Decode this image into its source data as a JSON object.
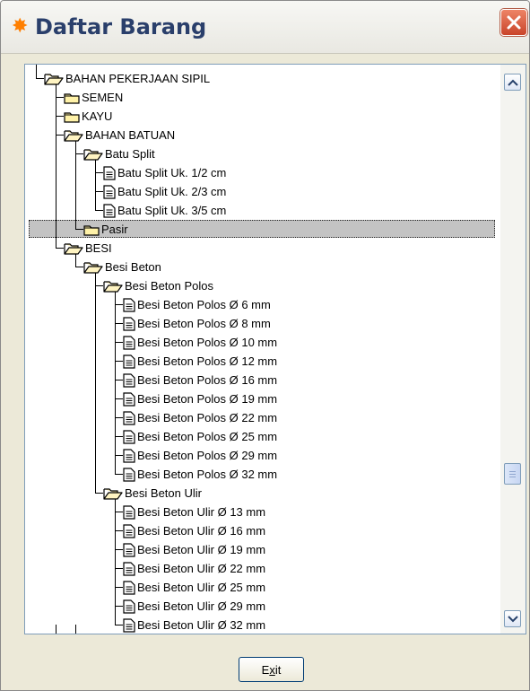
{
  "window": {
    "title": "Daftar Barang",
    "title_icon": "sun-icon",
    "close_icon": "close-icon",
    "accent_color": "#2a3f6b",
    "close_color": "#d9573a"
  },
  "tree": {
    "selected_label": "Pasir",
    "items": [
      {
        "label": "BAHAN PEKERJAAN SIPIL",
        "icon": "folder-open-icon",
        "level": 0
      },
      {
        "label": "SEMEN",
        "icon": "folder-icon",
        "level": 1
      },
      {
        "label": "KAYU",
        "icon": "folder-icon",
        "level": 1
      },
      {
        "label": "BAHAN BATUAN",
        "icon": "folder-open-icon",
        "level": 1
      },
      {
        "label": "Batu Split",
        "icon": "folder-open-icon",
        "level": 2
      },
      {
        "label": "Batu Split Uk. 1/2 cm",
        "icon": "document-icon",
        "level": 3
      },
      {
        "label": "Batu Split Uk. 2/3 cm",
        "icon": "document-icon",
        "level": 3
      },
      {
        "label": "Batu Split Uk. 3/5 cm",
        "icon": "document-icon",
        "level": 3
      },
      {
        "label": "Pasir",
        "icon": "folder-icon",
        "level": 2
      },
      {
        "label": "BESI",
        "icon": "folder-open-icon",
        "level": 1
      },
      {
        "label": "Besi Beton",
        "icon": "folder-open-icon",
        "level": 2
      },
      {
        "label": "Besi Beton Polos",
        "icon": "folder-open-icon",
        "level": 3
      },
      {
        "label": "Besi Beton Polos Ø 6 mm",
        "icon": "document-icon",
        "level": 4
      },
      {
        "label": "Besi Beton Polos Ø 8 mm",
        "icon": "document-icon",
        "level": 4
      },
      {
        "label": "Besi Beton Polos Ø 10 mm",
        "icon": "document-icon",
        "level": 4
      },
      {
        "label": "Besi Beton Polos Ø 12 mm",
        "icon": "document-icon",
        "level": 4
      },
      {
        "label": "Besi Beton Polos Ø 16 mm",
        "icon": "document-icon",
        "level": 4
      },
      {
        "label": "Besi Beton Polos Ø 19 mm",
        "icon": "document-icon",
        "level": 4
      },
      {
        "label": "Besi Beton Polos Ø 22 mm",
        "icon": "document-icon",
        "level": 4
      },
      {
        "label": "Besi Beton Polos Ø 25 mm",
        "icon": "document-icon",
        "level": 4
      },
      {
        "label": "Besi Beton Polos Ø 29 mm",
        "icon": "document-icon",
        "level": 4
      },
      {
        "label": "Besi Beton Polos Ø 32 mm",
        "icon": "document-icon",
        "level": 4
      },
      {
        "label": "Besi Beton Ulir",
        "icon": "folder-open-icon",
        "level": 3
      },
      {
        "label": "Besi Beton Ulir Ø 13 mm",
        "icon": "document-icon",
        "level": 4
      },
      {
        "label": "Besi Beton Ulir Ø 16 mm",
        "icon": "document-icon",
        "level": 4
      },
      {
        "label": "Besi Beton Ulir Ø 19 mm",
        "icon": "document-icon",
        "level": 4
      },
      {
        "label": "Besi Beton Ulir Ø 22 mm",
        "icon": "document-icon",
        "level": 4
      },
      {
        "label": "Besi Beton Ulir Ø 25 mm",
        "icon": "document-icon",
        "level": 4
      },
      {
        "label": "Besi Beton Ulir Ø 29 mm",
        "icon": "document-icon",
        "level": 4
      },
      {
        "label": "Besi Beton Ulir Ø 32 mm",
        "icon": "document-icon",
        "level": 4
      }
    ]
  },
  "scrollbar": {
    "up_icon": "chevron-up-icon",
    "down_icon": "chevron-down-icon",
    "thumb_icon": "grip-icon"
  },
  "footer": {
    "exit_label": "Exit",
    "exit_mnemonic": "x"
  }
}
